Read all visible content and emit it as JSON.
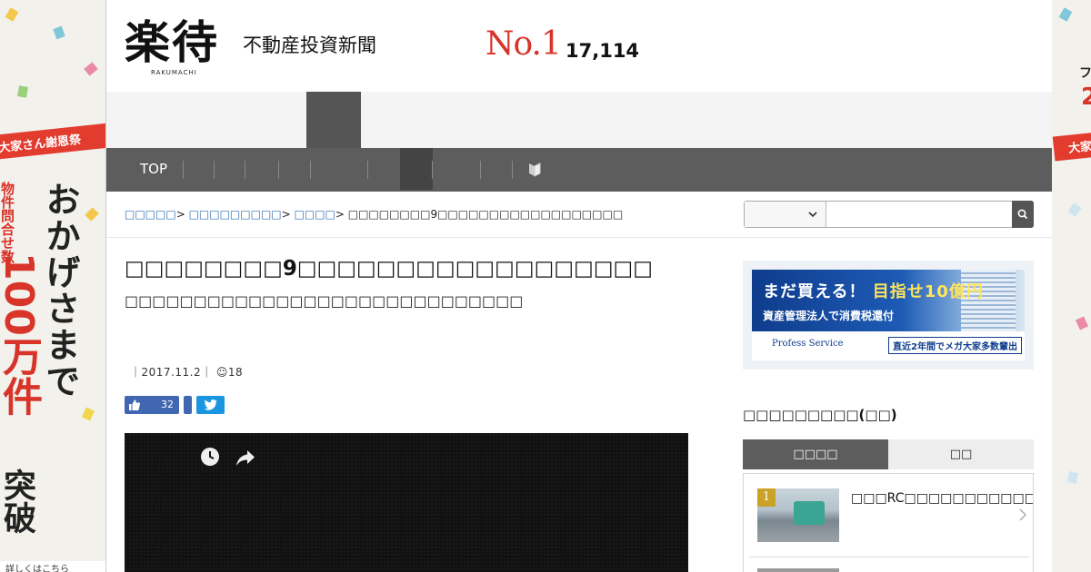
{
  "left_banner": {
    "ribbon": "大家さん謝恩祭",
    "red_vertical": "物件問合せ数",
    "main_vertical": "おかげさまで",
    "number_vertical": "100万件",
    "bottom_vertical": "突破",
    "more": "詳しくはこちら"
  },
  "right_banner": {
    "ribbon": "大家",
    "text_top": "フ",
    "num": "2"
  },
  "header": {
    "logo": "楽待",
    "logo_sub": "RAKUMACHI",
    "tagline": "不動産投資新聞",
    "no1": "No.1",
    "count": "17,114"
  },
  "nav": {
    "top_label": "TOP",
    "icon": "beginner-mark-icon"
  },
  "breadcrumb": {
    "items": [
      "□□□□□",
      "□□□□□□□□□",
      "□□□□"
    ],
    "current": "□□□□□□□□9□□□□□□□□□□□□□□□□□□"
  },
  "search": {
    "select_value": "",
    "placeholder": "",
    "icon": "search-icon"
  },
  "article": {
    "title": "□□□□□□□□9□□□□□□□□□□□□□□□□□□",
    "subtitle": "□□□□□□□□□□□□□□□□□□□□□□□□□□□□□",
    "meta_date": "｜2017.11.2｜",
    "meta_views": "☺18",
    "fb_count": "32"
  },
  "sidebar": {
    "ad_head_1": "まだ買える！",
    "ad_head_2": "目指せ10億円",
    "ad_sub": "資産管理法人で消費税還付",
    "ad_brand": "Profess Service",
    "ad_tag": "直近2年間でメガ大家多数輩出",
    "ranking_title": "□□□□□□□□□(□□)",
    "tab_active": "□□□□",
    "tab_inactive": "□□",
    "rank1_num": "1",
    "rank1_text": "□□□RC□□□□□□□□□□□□□□□□□"
  },
  "colors": {
    "nav_bg": "#5d5d5d",
    "accent_red": "#d8342a",
    "link_blue": "#2a6cb0",
    "fb_blue": "#4267b2",
    "tw_blue": "#1b95e0"
  }
}
